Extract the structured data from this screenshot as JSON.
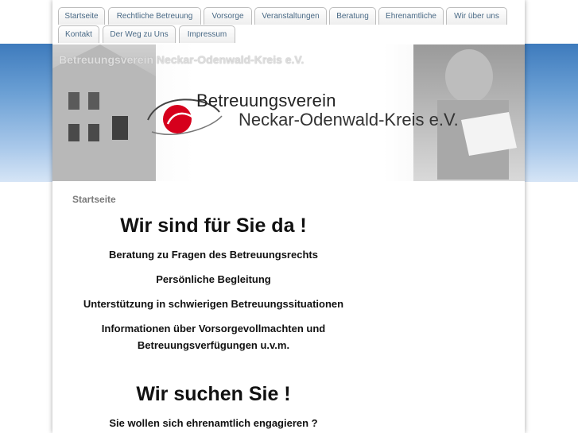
{
  "nav": {
    "row1": [
      "Startseite",
      "Rechtliche Betreuung",
      "Vorsorge",
      "Veranstaltungen",
      "Beratung",
      "Ehrenamtliche",
      "Wir über uns"
    ],
    "row2": [
      "Kontakt",
      "Der Weg zu Uns",
      "Impressum"
    ]
  },
  "header": {
    "site_title": "Betreuungsverein Neckar-Odenwald-Kreis e.V.",
    "logo_line1": "Betreuungsverein",
    "logo_line2": "Neckar-Odenwald-Kreis e.V."
  },
  "content": {
    "breadcrumb": "Startseite",
    "headline1": "Wir sind für Sie da !",
    "items": [
      "Beratung zu Fragen des Betreuungsrechts",
      "Persönliche Begleitung",
      "Unterstützung in schwierigen Betreuungssituationen",
      "Informationen über Vorsorgevollmachten und Betreuungsverfügungen u.v.m."
    ],
    "headline2": "Wir suchen Sie !",
    "sub2": "Sie wollen sich ehrenamtlich engagieren ?"
  },
  "colors": {
    "accent_red": "#d6001c",
    "nav_text": "#4a6a86",
    "band_blue": "#3e7bbd"
  }
}
